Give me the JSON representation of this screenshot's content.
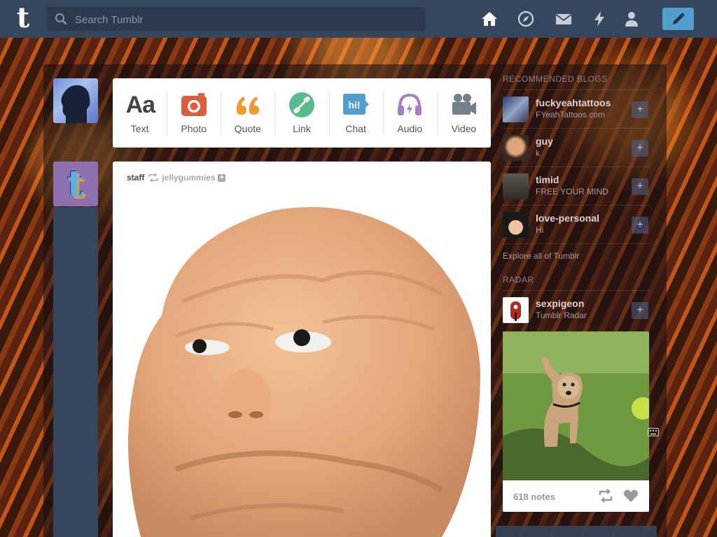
{
  "search": {
    "placeholder": "Search Tumblr"
  },
  "nav": {
    "icons": [
      "home-icon",
      "compass-icon",
      "mail-icon",
      "lightning-icon",
      "person-icon",
      "pencil-icon"
    ]
  },
  "post_types": [
    {
      "label": "Text",
      "icon": "text-aa-icon",
      "color": "#444444"
    },
    {
      "label": "Photo",
      "icon": "camera-icon",
      "color": "#d95e40"
    },
    {
      "label": "Quote",
      "icon": "quote-icon",
      "color": "#f2992e"
    },
    {
      "label": "Link",
      "icon": "link-icon",
      "color": "#56bc8a"
    },
    {
      "label": "Chat",
      "icon": "chat-icon",
      "color": "#529ecc"
    },
    {
      "label": "Audio",
      "icon": "headphones-icon",
      "color": "#a77dc2"
    },
    {
      "label": "Video",
      "icon": "video-camera-icon",
      "color": "#748089"
    }
  ],
  "post": {
    "author": "staff",
    "reblogged_from": "jellygummies"
  },
  "sidebar": {
    "recommended_title": "RECOMMENDED BLOGS",
    "blogs": [
      {
        "name": "fuckyeahtattoos",
        "subtitle": "FYeahTattoos.com"
      },
      {
        "name": "guy",
        "subtitle": "k"
      },
      {
        "name": "timid",
        "subtitle": "FREE YOUR MIND"
      },
      {
        "name": "love-personal",
        "subtitle": "Hi"
      }
    ],
    "explore_link": "Explore all of Tumblr",
    "radar_title": "RADAR",
    "radar": {
      "name": "sexpigeon",
      "subtitle": "Tumblr Radar",
      "notes": "618 notes"
    }
  },
  "colors": {
    "nav_bg": "#36465d",
    "accent_blue": "#529ecc"
  }
}
